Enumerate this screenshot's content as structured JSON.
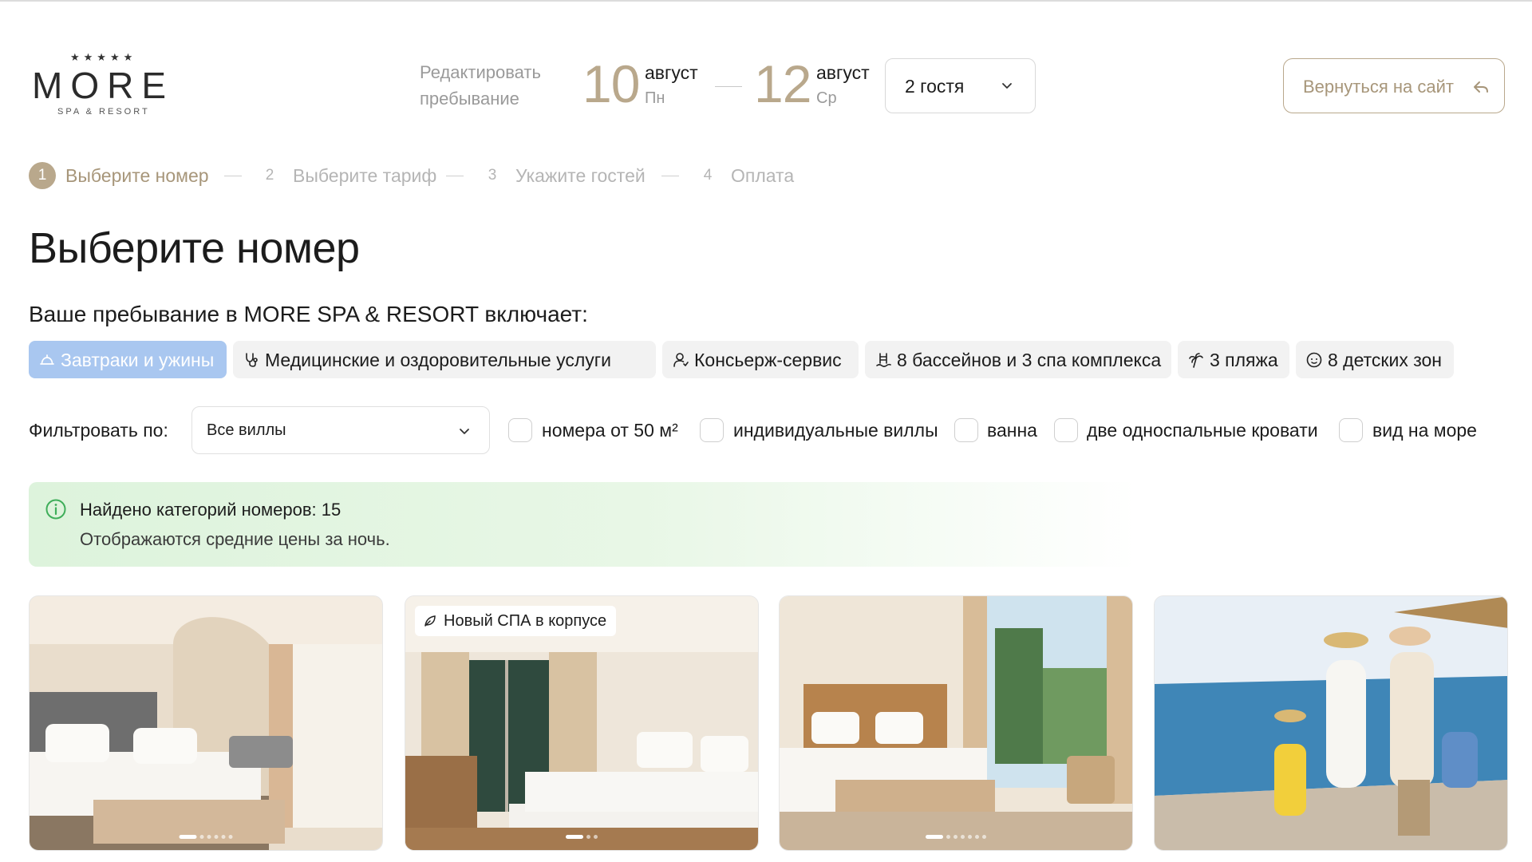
{
  "brand": {
    "stars": "★★★★★",
    "name": "MORE",
    "subtitle": "SPA & RESORT"
  },
  "stay": {
    "edit_label": "Редактировать пребывание",
    "check_in": {
      "day": "10",
      "month": "август",
      "weekday": "Пн"
    },
    "check_out": {
      "day": "12",
      "month": "август",
      "weekday": "Ср"
    },
    "guests": "2 гостя"
  },
  "back_button": "Вернуться на сайт",
  "steps": [
    {
      "num": "1",
      "label": "Выберите номер",
      "active": true
    },
    {
      "num": "2",
      "label": "Выберите тариф",
      "active": false
    },
    {
      "num": "3",
      "label": "Укажите гостей",
      "active": false
    },
    {
      "num": "4",
      "label": "Оплата",
      "active": false
    }
  ],
  "page_title": "Выберите номер",
  "includes_title": "Ваше пребывание в MORE SPA & RESORT включает:",
  "amenities": [
    {
      "label": "Завтраки и ужины",
      "icon": "cloche-icon",
      "active": true
    },
    {
      "label": "Медицинские и оздоровительные услуги",
      "icon": "stethoscope-icon",
      "active": false
    },
    {
      "label": "Консьерж-сервис",
      "icon": "concierge-icon",
      "active": false
    },
    {
      "label": "8 бассейнов и 3 спа комплекса",
      "icon": "pool-ladder-icon",
      "active": false
    },
    {
      "label": "3 пляжа",
      "icon": "palm-tree-icon",
      "active": false
    },
    {
      "label": "8 детских зон",
      "icon": "baby-face-icon",
      "active": false
    }
  ],
  "filter": {
    "label": "Фильтровать по:",
    "select_value": "Все виллы",
    "checkboxes": [
      "номера от 50 м²",
      "индивидуальные виллы",
      "ванна",
      "две односпальные кровати",
      "вид на море"
    ]
  },
  "info": {
    "title": "Найдено категорий номеров: 15",
    "subtitle": "Отображаются средние цены за ночь."
  },
  "cards": [
    {
      "badge": "",
      "dots": 6,
      "active_dot": 0
    },
    {
      "badge": "Новый СПА в корпусе",
      "dots": 3,
      "active_dot": 0
    },
    {
      "badge": "",
      "dots": 7,
      "active_dot": 0
    },
    {
      "badge": "",
      "dots": 0,
      "active_dot": 0
    }
  ],
  "colors": {
    "accent": "#b9a88c",
    "chip_active": "#a9c7f0",
    "info_bg": "#ddf3dc",
    "info_icon": "#3fae5a"
  }
}
